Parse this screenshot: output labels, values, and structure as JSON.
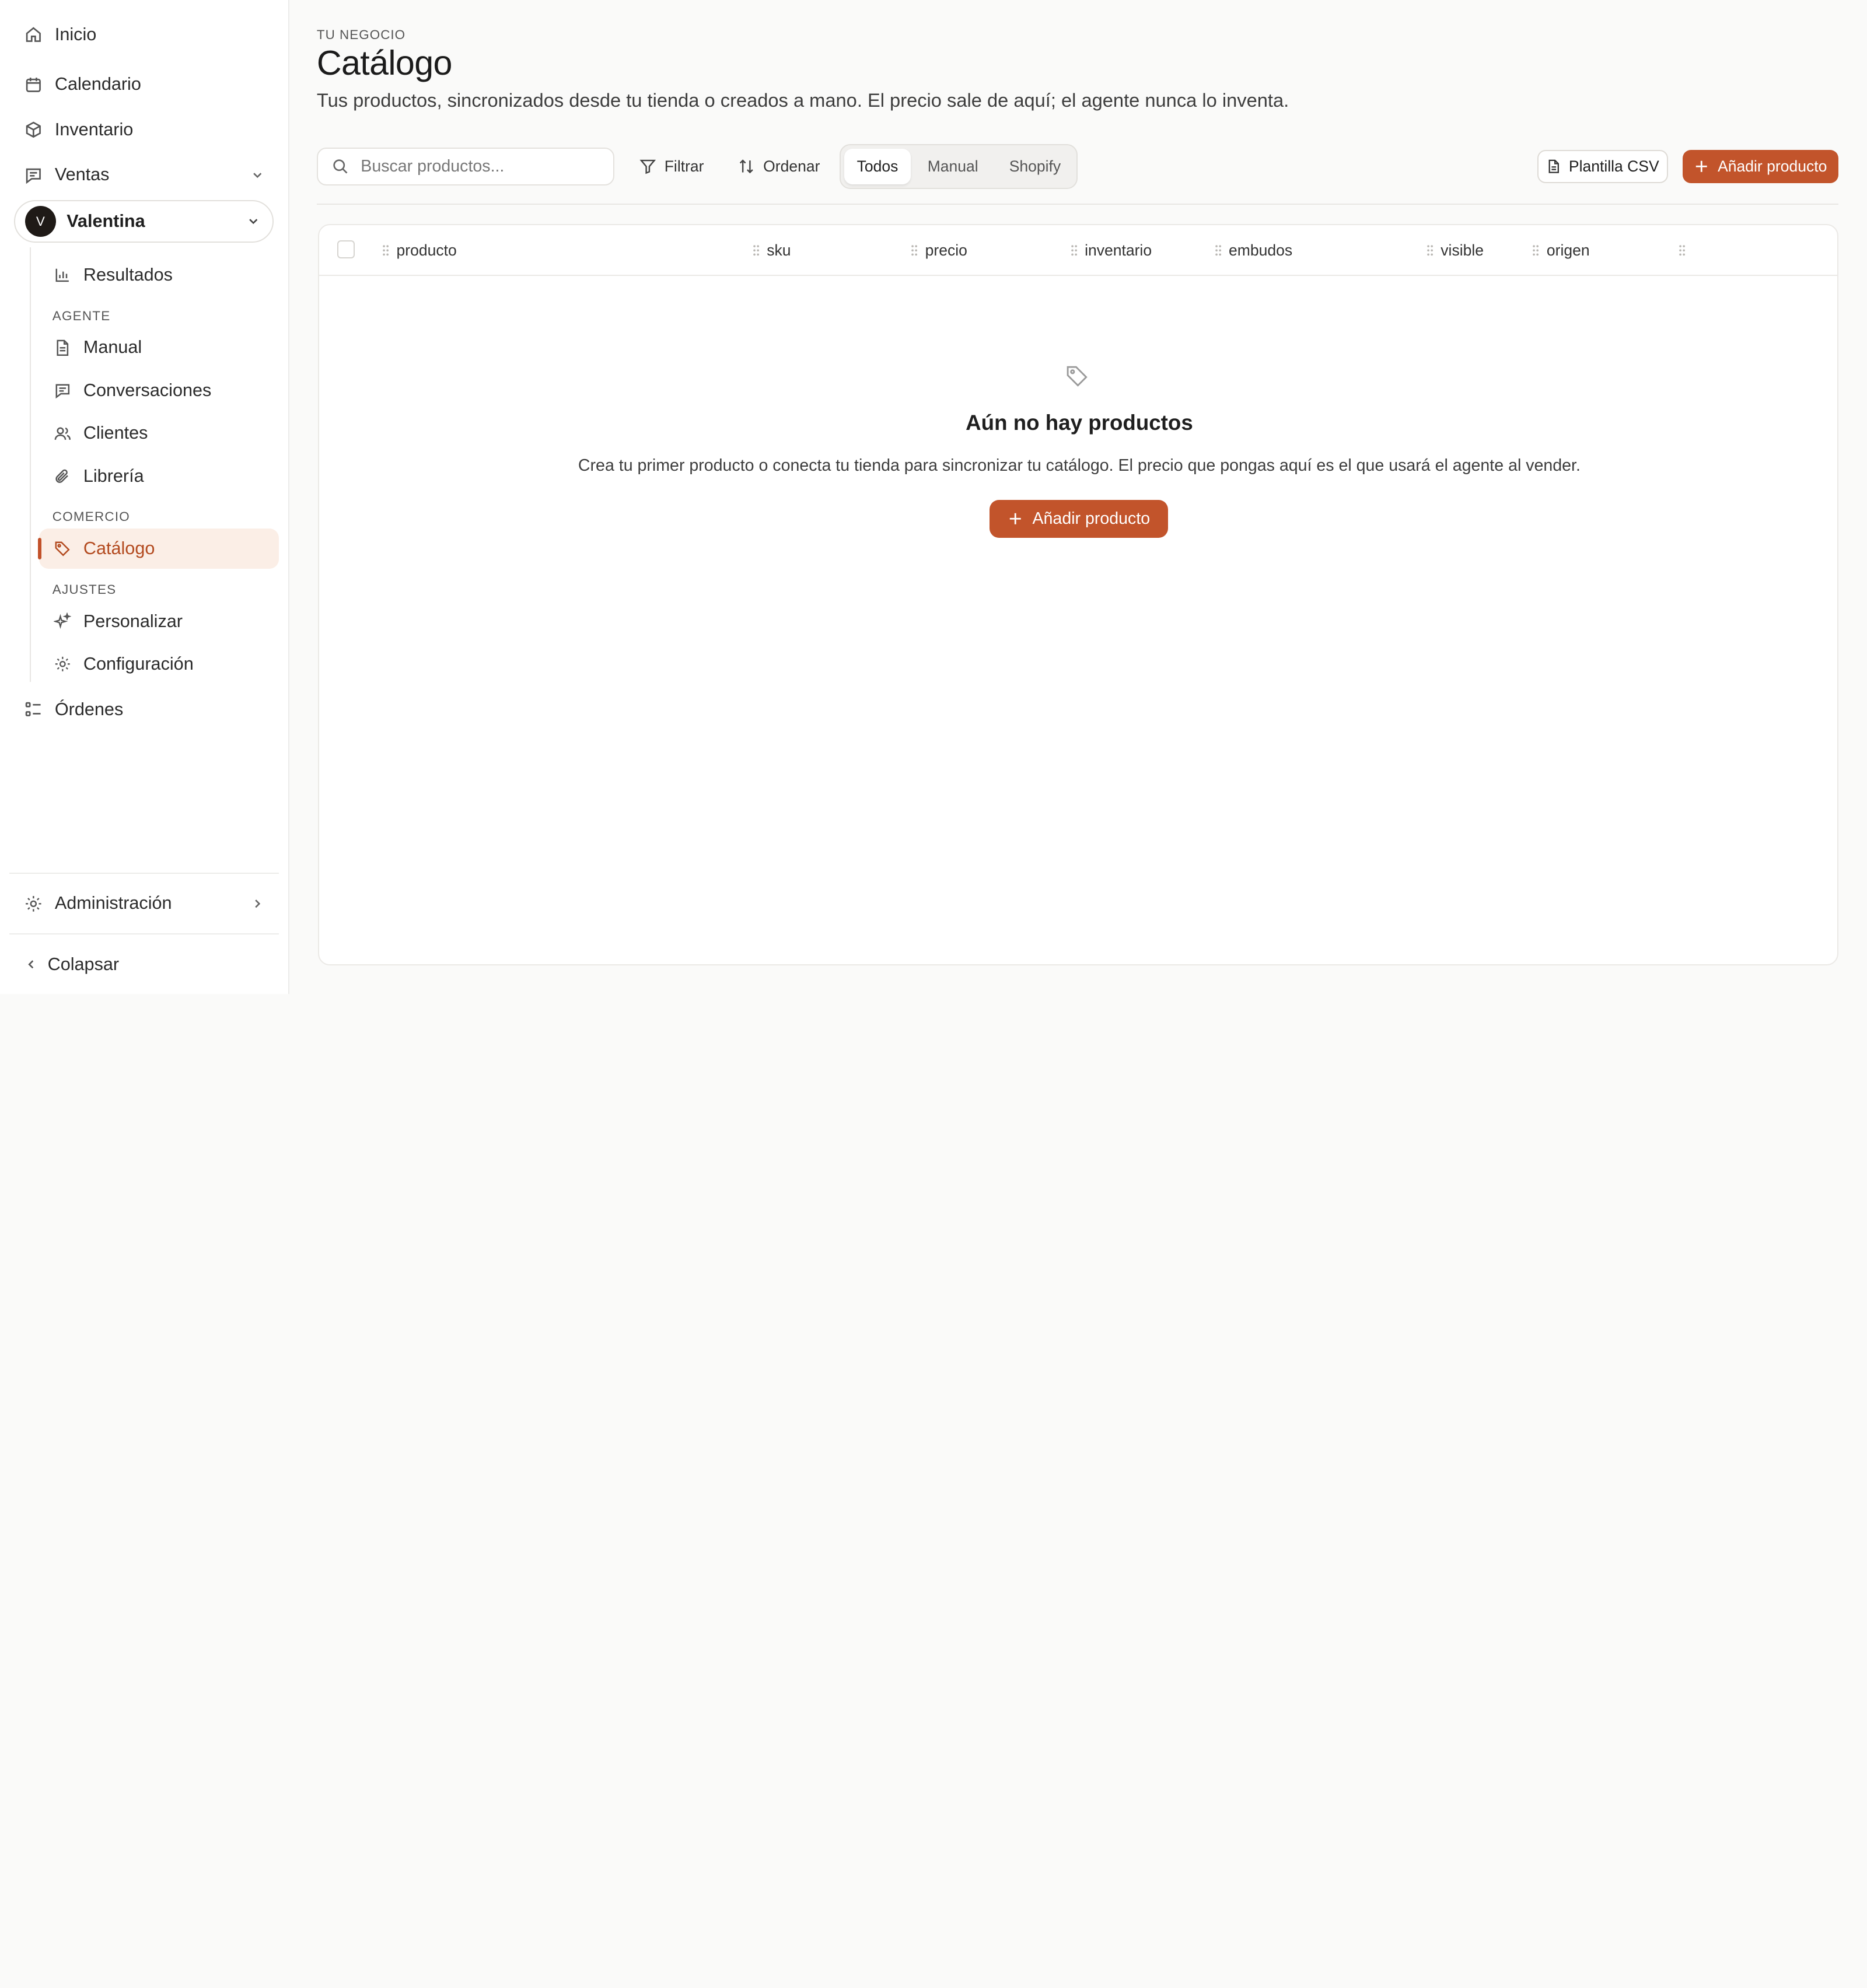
{
  "sidebar": {
    "inicio": "Inicio",
    "calendario": "Calendario",
    "inventario": "Inventario",
    "ventas": "Ventas",
    "user": {
      "initial": "V",
      "name": "Valentina"
    },
    "resultados": "Resultados",
    "section_agente": "AGENTE",
    "manual": "Manual",
    "conversaciones": "Conversaciones",
    "clientes": "Clientes",
    "libreria": "Librería",
    "section_comercio": "COMERCIO",
    "catalogo": "Catálogo",
    "section_ajustes": "AJUSTES",
    "personalizar": "Personalizar",
    "configuracion": "Configuración",
    "ordenes": "Órdenes",
    "administracion": "Administración",
    "colapsar": "Colapsar"
  },
  "header": {
    "eyebrow": "TU NEGOCIO",
    "title": "Catálogo",
    "subtitle": "Tus productos, sincronizados desde tu tienda o creados a mano. El precio sale de aquí; el agente nunca lo inventa."
  },
  "toolbar": {
    "search_placeholder": "Buscar productos...",
    "filter": "Filtrar",
    "sort": "Ordenar",
    "segments": [
      "Todos",
      "Manual",
      "Shopify"
    ],
    "csv_template": "Plantilla CSV",
    "add_product": "Añadir producto"
  },
  "table": {
    "columns": [
      "producto",
      "sku",
      "precio",
      "inventario",
      "embudos",
      "visible",
      "origen"
    ]
  },
  "empty_state": {
    "icon": "tag-icon",
    "title": "Aún no hay productos",
    "description": "Crea tu primer producto o conecta tu tienda para sincronizar tu catálogo. El precio que pongas aquí es el que usará el agente al vender.",
    "button": "Añadir producto"
  },
  "colors": {
    "accent": "#c2542b",
    "active_bg": "#fbeee6"
  }
}
